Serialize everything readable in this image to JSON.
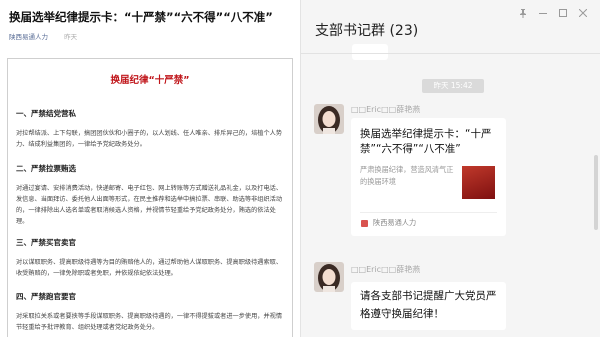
{
  "article": {
    "title": "换届选举纪律提示卡：“十严禁”“六不得”“八不准”",
    "source": "陕西易通人力",
    "extra": "昨天",
    "doc_heading": "换届纪律“十严禁”",
    "sections": [
      {
        "heading": "一、严禁结党营私",
        "body": "对拉帮结派、上下勾联，搞团团伙伙和小圈子的，以人划线、任人唯亲、排斥异己的，培植个人势力、结成利益集团的，一律给予党纪政务处分。"
      },
      {
        "heading": "二、严禁拉票贿选",
        "body": "对通过宴请、安排消费活动，快递邮寄、电子红包、网上转账等方式赠送礼品礼金，以及打电话、发信息、当面拜访、委托他人出面等形式，在民主推荐和选举中搞拉票、串联、助选等非组织活动的，一律排除出人选名单或者取消候选人资格，并视情节轻重给予党纪政务处分，贿选的依法处理。"
      },
      {
        "heading": "三、严禁买官卖官",
        "body": "对以谋取职务、提高职级待遇等为目的贿赂他人的，通过帮助他人谋取职务、提高职级待遇索取、收受贿赂的，一律免除职或者免职，并依规依纪依法处理。"
      },
      {
        "heading": "四、严禁跑官要官",
        "body": "对采取拉关系或者要挟等手段谋取职务、提高职级待遇的，一律不得提拔或者进一步使用，并视情节轻重给予批评教育、组织处理或者党纪政务处分。"
      }
    ]
  },
  "chat": {
    "title": "支部书记群 (23)",
    "timestamp": "昨天 15:42",
    "messages": [
      {
        "sender": "□□Eric□□薛艳燕",
        "card": {
          "title": "换届选举纪律提示卡：“十严禁”“六不得”“八不准”",
          "desc": "严肃换届纪律，营造风清气正的换届环境",
          "source": "陕西易通人力"
        }
      },
      {
        "sender": "□□Eric□□薛艳燕",
        "text": "请各支部书记提醒广大党员严格遵守换届纪律！"
      }
    ]
  },
  "colors": {
    "accent_red": "#c0161b",
    "link_blue": "#576b95",
    "chat_bg": "#f5f5f5"
  },
  "icons": [
    "pin-icon",
    "minimize-icon",
    "maximize-icon",
    "close-icon",
    "article-source-icon"
  ]
}
